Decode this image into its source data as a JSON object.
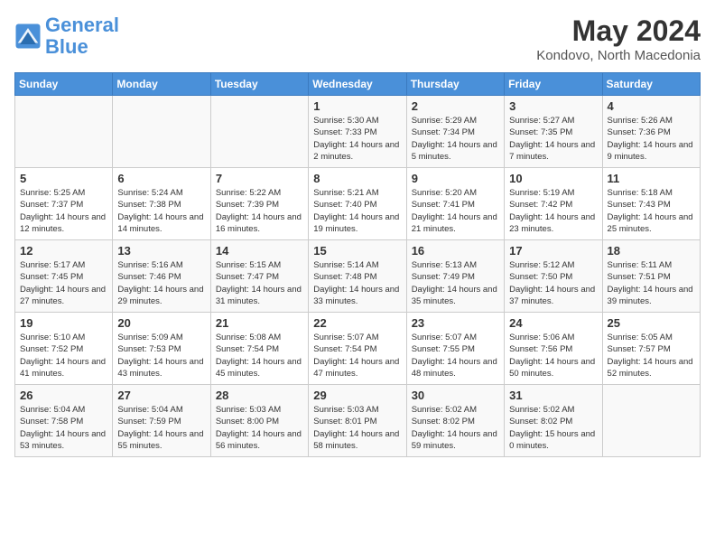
{
  "logo": {
    "line1": "General",
    "line2": "Blue"
  },
  "title": "May 2024",
  "location": "Kondovo, North Macedonia",
  "days_header": [
    "Sunday",
    "Monday",
    "Tuesday",
    "Wednesday",
    "Thursday",
    "Friday",
    "Saturday"
  ],
  "weeks": [
    [
      {
        "day": "",
        "sunrise": "",
        "sunset": "",
        "daylight": ""
      },
      {
        "day": "",
        "sunrise": "",
        "sunset": "",
        "daylight": ""
      },
      {
        "day": "",
        "sunrise": "",
        "sunset": "",
        "daylight": ""
      },
      {
        "day": "1",
        "sunrise": "Sunrise: 5:30 AM",
        "sunset": "Sunset: 7:33 PM",
        "daylight": "Daylight: 14 hours and 2 minutes."
      },
      {
        "day": "2",
        "sunrise": "Sunrise: 5:29 AM",
        "sunset": "Sunset: 7:34 PM",
        "daylight": "Daylight: 14 hours and 5 minutes."
      },
      {
        "day": "3",
        "sunrise": "Sunrise: 5:27 AM",
        "sunset": "Sunset: 7:35 PM",
        "daylight": "Daylight: 14 hours and 7 minutes."
      },
      {
        "day": "4",
        "sunrise": "Sunrise: 5:26 AM",
        "sunset": "Sunset: 7:36 PM",
        "daylight": "Daylight: 14 hours and 9 minutes."
      }
    ],
    [
      {
        "day": "5",
        "sunrise": "Sunrise: 5:25 AM",
        "sunset": "Sunset: 7:37 PM",
        "daylight": "Daylight: 14 hours and 12 minutes."
      },
      {
        "day": "6",
        "sunrise": "Sunrise: 5:24 AM",
        "sunset": "Sunset: 7:38 PM",
        "daylight": "Daylight: 14 hours and 14 minutes."
      },
      {
        "day": "7",
        "sunrise": "Sunrise: 5:22 AM",
        "sunset": "Sunset: 7:39 PM",
        "daylight": "Daylight: 14 hours and 16 minutes."
      },
      {
        "day": "8",
        "sunrise": "Sunrise: 5:21 AM",
        "sunset": "Sunset: 7:40 PM",
        "daylight": "Daylight: 14 hours and 19 minutes."
      },
      {
        "day": "9",
        "sunrise": "Sunrise: 5:20 AM",
        "sunset": "Sunset: 7:41 PM",
        "daylight": "Daylight: 14 hours and 21 minutes."
      },
      {
        "day": "10",
        "sunrise": "Sunrise: 5:19 AM",
        "sunset": "Sunset: 7:42 PM",
        "daylight": "Daylight: 14 hours and 23 minutes."
      },
      {
        "day": "11",
        "sunrise": "Sunrise: 5:18 AM",
        "sunset": "Sunset: 7:43 PM",
        "daylight": "Daylight: 14 hours and 25 minutes."
      }
    ],
    [
      {
        "day": "12",
        "sunrise": "Sunrise: 5:17 AM",
        "sunset": "Sunset: 7:45 PM",
        "daylight": "Daylight: 14 hours and 27 minutes."
      },
      {
        "day": "13",
        "sunrise": "Sunrise: 5:16 AM",
        "sunset": "Sunset: 7:46 PM",
        "daylight": "Daylight: 14 hours and 29 minutes."
      },
      {
        "day": "14",
        "sunrise": "Sunrise: 5:15 AM",
        "sunset": "Sunset: 7:47 PM",
        "daylight": "Daylight: 14 hours and 31 minutes."
      },
      {
        "day": "15",
        "sunrise": "Sunrise: 5:14 AM",
        "sunset": "Sunset: 7:48 PM",
        "daylight": "Daylight: 14 hours and 33 minutes."
      },
      {
        "day": "16",
        "sunrise": "Sunrise: 5:13 AM",
        "sunset": "Sunset: 7:49 PM",
        "daylight": "Daylight: 14 hours and 35 minutes."
      },
      {
        "day": "17",
        "sunrise": "Sunrise: 5:12 AM",
        "sunset": "Sunset: 7:50 PM",
        "daylight": "Daylight: 14 hours and 37 minutes."
      },
      {
        "day": "18",
        "sunrise": "Sunrise: 5:11 AM",
        "sunset": "Sunset: 7:51 PM",
        "daylight": "Daylight: 14 hours and 39 minutes."
      }
    ],
    [
      {
        "day": "19",
        "sunrise": "Sunrise: 5:10 AM",
        "sunset": "Sunset: 7:52 PM",
        "daylight": "Daylight: 14 hours and 41 minutes."
      },
      {
        "day": "20",
        "sunrise": "Sunrise: 5:09 AM",
        "sunset": "Sunset: 7:53 PM",
        "daylight": "Daylight: 14 hours and 43 minutes."
      },
      {
        "day": "21",
        "sunrise": "Sunrise: 5:08 AM",
        "sunset": "Sunset: 7:54 PM",
        "daylight": "Daylight: 14 hours and 45 minutes."
      },
      {
        "day": "22",
        "sunrise": "Sunrise: 5:07 AM",
        "sunset": "Sunset: 7:54 PM",
        "daylight": "Daylight: 14 hours and 47 minutes."
      },
      {
        "day": "23",
        "sunrise": "Sunrise: 5:07 AM",
        "sunset": "Sunset: 7:55 PM",
        "daylight": "Daylight: 14 hours and 48 minutes."
      },
      {
        "day": "24",
        "sunrise": "Sunrise: 5:06 AM",
        "sunset": "Sunset: 7:56 PM",
        "daylight": "Daylight: 14 hours and 50 minutes."
      },
      {
        "day": "25",
        "sunrise": "Sunrise: 5:05 AM",
        "sunset": "Sunset: 7:57 PM",
        "daylight": "Daylight: 14 hours and 52 minutes."
      }
    ],
    [
      {
        "day": "26",
        "sunrise": "Sunrise: 5:04 AM",
        "sunset": "Sunset: 7:58 PM",
        "daylight": "Daylight: 14 hours and 53 minutes."
      },
      {
        "day": "27",
        "sunrise": "Sunrise: 5:04 AM",
        "sunset": "Sunset: 7:59 PM",
        "daylight": "Daylight: 14 hours and 55 minutes."
      },
      {
        "day": "28",
        "sunrise": "Sunrise: 5:03 AM",
        "sunset": "Sunset: 8:00 PM",
        "daylight": "Daylight: 14 hours and 56 minutes."
      },
      {
        "day": "29",
        "sunrise": "Sunrise: 5:03 AM",
        "sunset": "Sunset: 8:01 PM",
        "daylight": "Daylight: 14 hours and 58 minutes."
      },
      {
        "day": "30",
        "sunrise": "Sunrise: 5:02 AM",
        "sunset": "Sunset: 8:02 PM",
        "daylight": "Daylight: 14 hours and 59 minutes."
      },
      {
        "day": "31",
        "sunrise": "Sunrise: 5:02 AM",
        "sunset": "Sunset: 8:02 PM",
        "daylight": "Daylight: 15 hours and 0 minutes."
      },
      {
        "day": "",
        "sunrise": "",
        "sunset": "",
        "daylight": ""
      }
    ]
  ]
}
